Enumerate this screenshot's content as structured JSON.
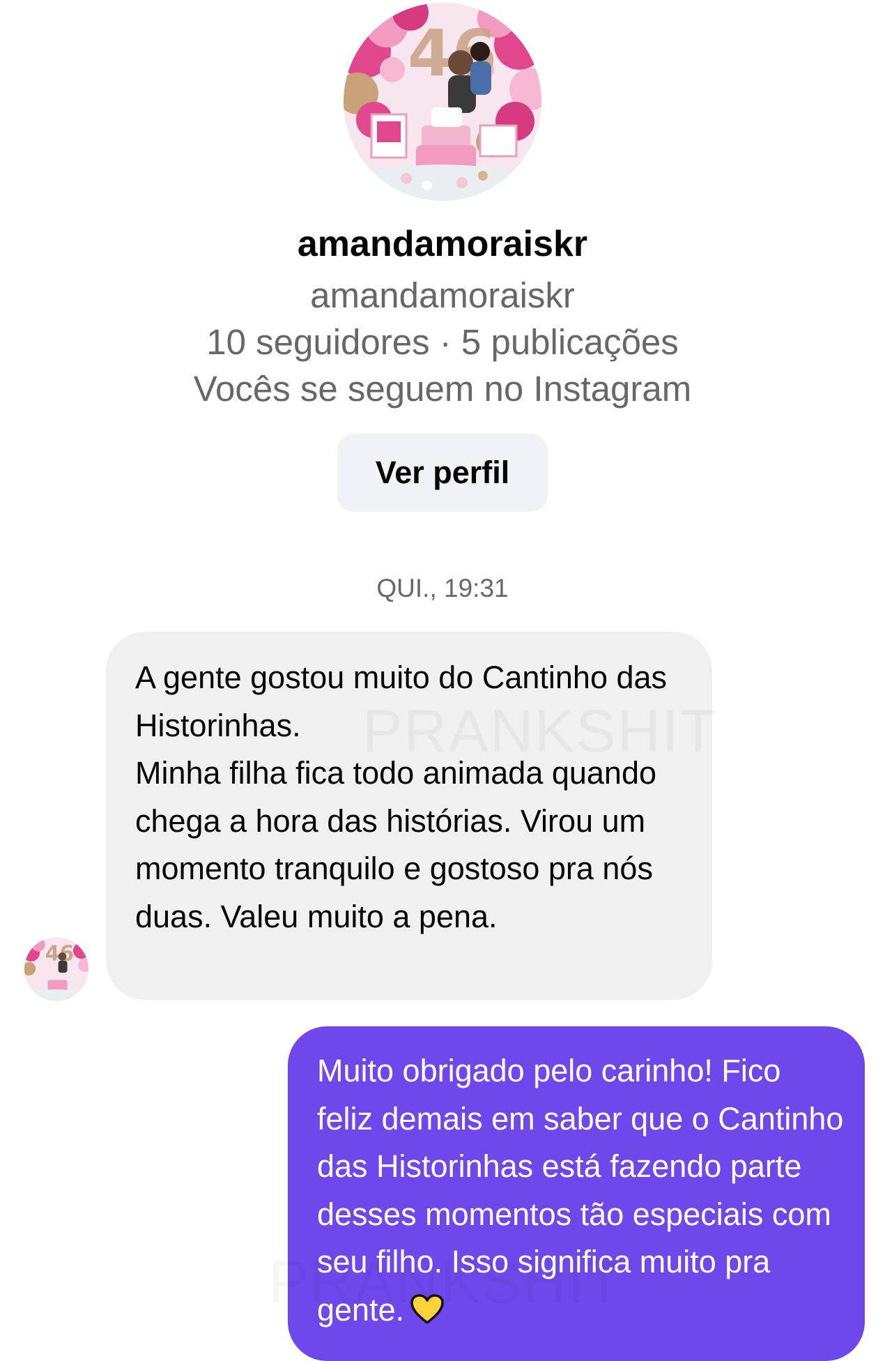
{
  "profile": {
    "photo_icon": "profile-photo-birthday-party",
    "display_name": "amandamoraiskr",
    "username": "amandamoraiskr",
    "stats": "10 seguidores · 5 publicações",
    "mutual": "Vocês se seguem no Instagram",
    "view_profile_label": "Ver perfil"
  },
  "conversation": {
    "timestamp": "QUI., 19:31",
    "messages": [
      {
        "direction": "incoming",
        "text": "A gente gostou muito do Cantinho das Historinhas.\nMinha filha fica todo animada quando chega a hora das histórias. Virou um momento tranquilo e gostoso pra nós duas. Valeu muito a pena."
      },
      {
        "direction": "outgoing",
        "text": "Muito obrigado pelo carinho! Fico feliz demais em saber que o Cantinho das Historinhas está fazendo parte desses momentos tão especiais com seu filho. Isso significa muito pra gente.",
        "emoji": "yellow-heart-icon"
      }
    ]
  },
  "watermark": "PRANKSHIT",
  "colors": {
    "outgoing_bubble": "#6e48eb",
    "incoming_bubble": "#f0f0f0",
    "secondary_text": "#65676b",
    "button_bg": "#f0f2f5",
    "heart": "#ffd43b"
  }
}
